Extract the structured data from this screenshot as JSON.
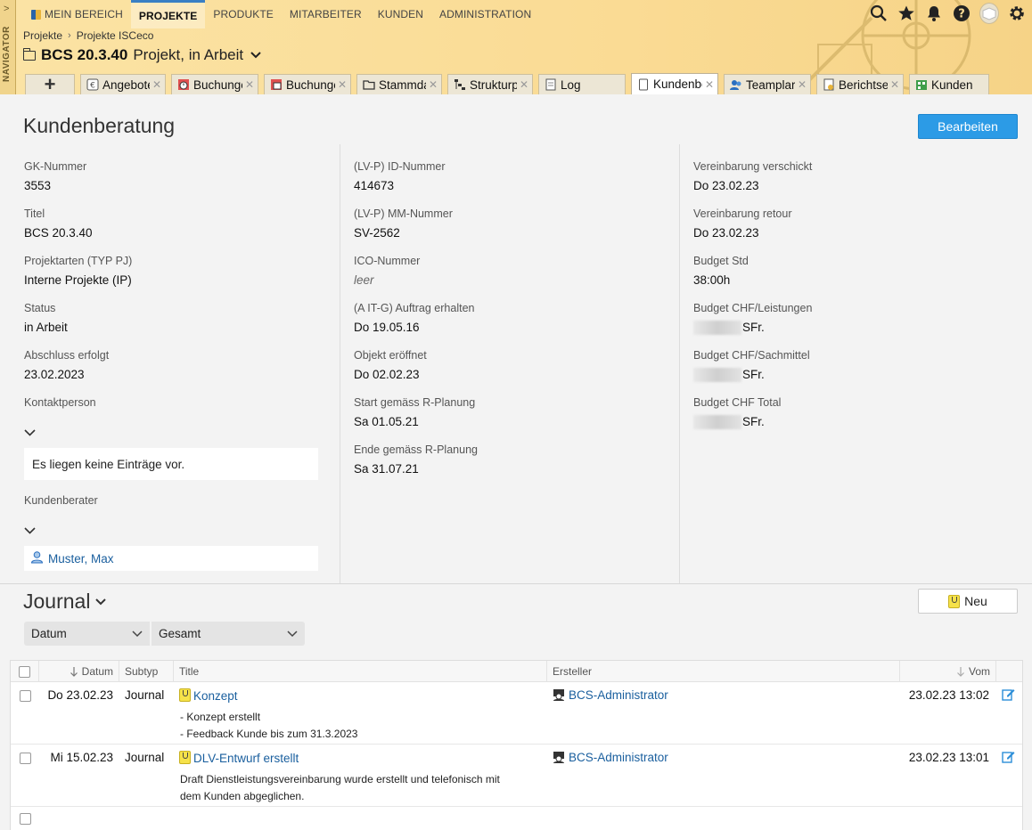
{
  "navigator": {
    "label": "NAVIGATOR"
  },
  "topmenu": [
    {
      "label": "MEIN BEREICH"
    },
    {
      "label": "PROJEKTE"
    },
    {
      "label": "PRODUKTE"
    },
    {
      "label": "MITARBEITER"
    },
    {
      "label": "KUNDEN"
    },
    {
      "label": "ADMINISTRATION"
    }
  ],
  "breadcrumb": {
    "items": [
      "Projekte",
      "Projekte ISCeco"
    ],
    "separator": "›"
  },
  "project": {
    "name": "BCS 20.3.40",
    "subtitle": "Projekt, in Arbeit"
  },
  "tabs": [
    {
      "label": "Angebote"
    },
    {
      "label": "Buchunge"
    },
    {
      "label": "Buchunge"
    },
    {
      "label": "Stammda"
    },
    {
      "label": "Strukturp"
    },
    {
      "label": "Log"
    },
    {
      "label": "Kundenbe"
    },
    {
      "label": "Teamplar"
    },
    {
      "label": "Berichtse"
    },
    {
      "label": "Kunden"
    }
  ],
  "tab_close_glyph": "✕",
  "page": {
    "title": "Kundenberatung",
    "edit_label": "Bearbeiten"
  },
  "col1": {
    "fields": [
      {
        "label": "GK-Nummer",
        "value": "3553"
      },
      {
        "label": "Titel",
        "value": "BCS 20.3.40"
      },
      {
        "label": "Projektarten (TYP PJ)",
        "value": "Interne Projekte (IP)"
      },
      {
        "label": "Status",
        "value": "in Arbeit"
      },
      {
        "label": "Abschluss erfolgt",
        "value": "23.02.2023"
      }
    ],
    "kontakt_label": "Kontaktperson",
    "kontakt_empty": "Es liegen keine Einträge vor.",
    "berater_label": "Kundenberater",
    "berater_name": "Muster, Max"
  },
  "col2": {
    "fields": [
      {
        "label": "(LV-P) ID-Nummer",
        "value": "414673"
      },
      {
        "label": "(LV-P) MM-Nummer",
        "value": "SV-2562"
      },
      {
        "label": "ICO-Nummer",
        "value": "leer"
      },
      {
        "label": "(A IT-G) Auftrag erhalten",
        "value": "Do 19.05.16"
      },
      {
        "label": "Objekt eröffnet",
        "value": "Do 02.02.23"
      },
      {
        "label": "Start gemäss R-Planung",
        "value": "Sa 01.05.21"
      },
      {
        "label": "Ende gemäss R-Planung",
        "value": "Sa 31.07.21"
      }
    ]
  },
  "col3": {
    "fields": [
      {
        "label": "Vereinbarung verschickt",
        "value": "Do 23.02.23"
      },
      {
        "label": "Vereinbarung retour",
        "value": "Do 23.02.23"
      },
      {
        "label": "Budget Std",
        "value": "38:00h"
      },
      {
        "label": "Budget CHF/Leistungen",
        "value": "SFr."
      },
      {
        "label": "Budget CHF/Sachmittel",
        "value": "SFr."
      },
      {
        "label": "Budget CHF Total",
        "value": "SFr."
      }
    ]
  },
  "journal": {
    "title": "Journal",
    "new_label": "Neu",
    "filter_date": "Datum",
    "filter_scope": "Gesamt",
    "columns": {
      "datum": "Datum",
      "subtyp": "Subtyp",
      "title": "Title",
      "ersteller": "Ersteller",
      "vom": "Vom"
    },
    "rows": [
      {
        "datum": "Do 23.02.23",
        "subtyp": "Journal",
        "title": "Konzept",
        "desc": [
          "- Konzept erstellt",
          "- Feedback Kunde bis zum 31.3.2023"
        ],
        "ersteller": "BCS-Administrator",
        "vom": "23.02.23 13:02"
      },
      {
        "datum": "Mi 15.02.23",
        "subtyp": "Journal",
        "title": "DLV-Entwurf erstellt",
        "desc": [
          "Draft Dienstleistungsvereinbarung wurde erstellt und telefonisch mit",
          "dem Kunden abgeglichen."
        ],
        "ersteller": "BCS-Administrator",
        "vom": "23.02.23 13:01"
      }
    ]
  },
  "colors": {
    "accent": "#2c9be6",
    "header_bg": "#fadb94",
    "link": "#1a5f9e"
  }
}
